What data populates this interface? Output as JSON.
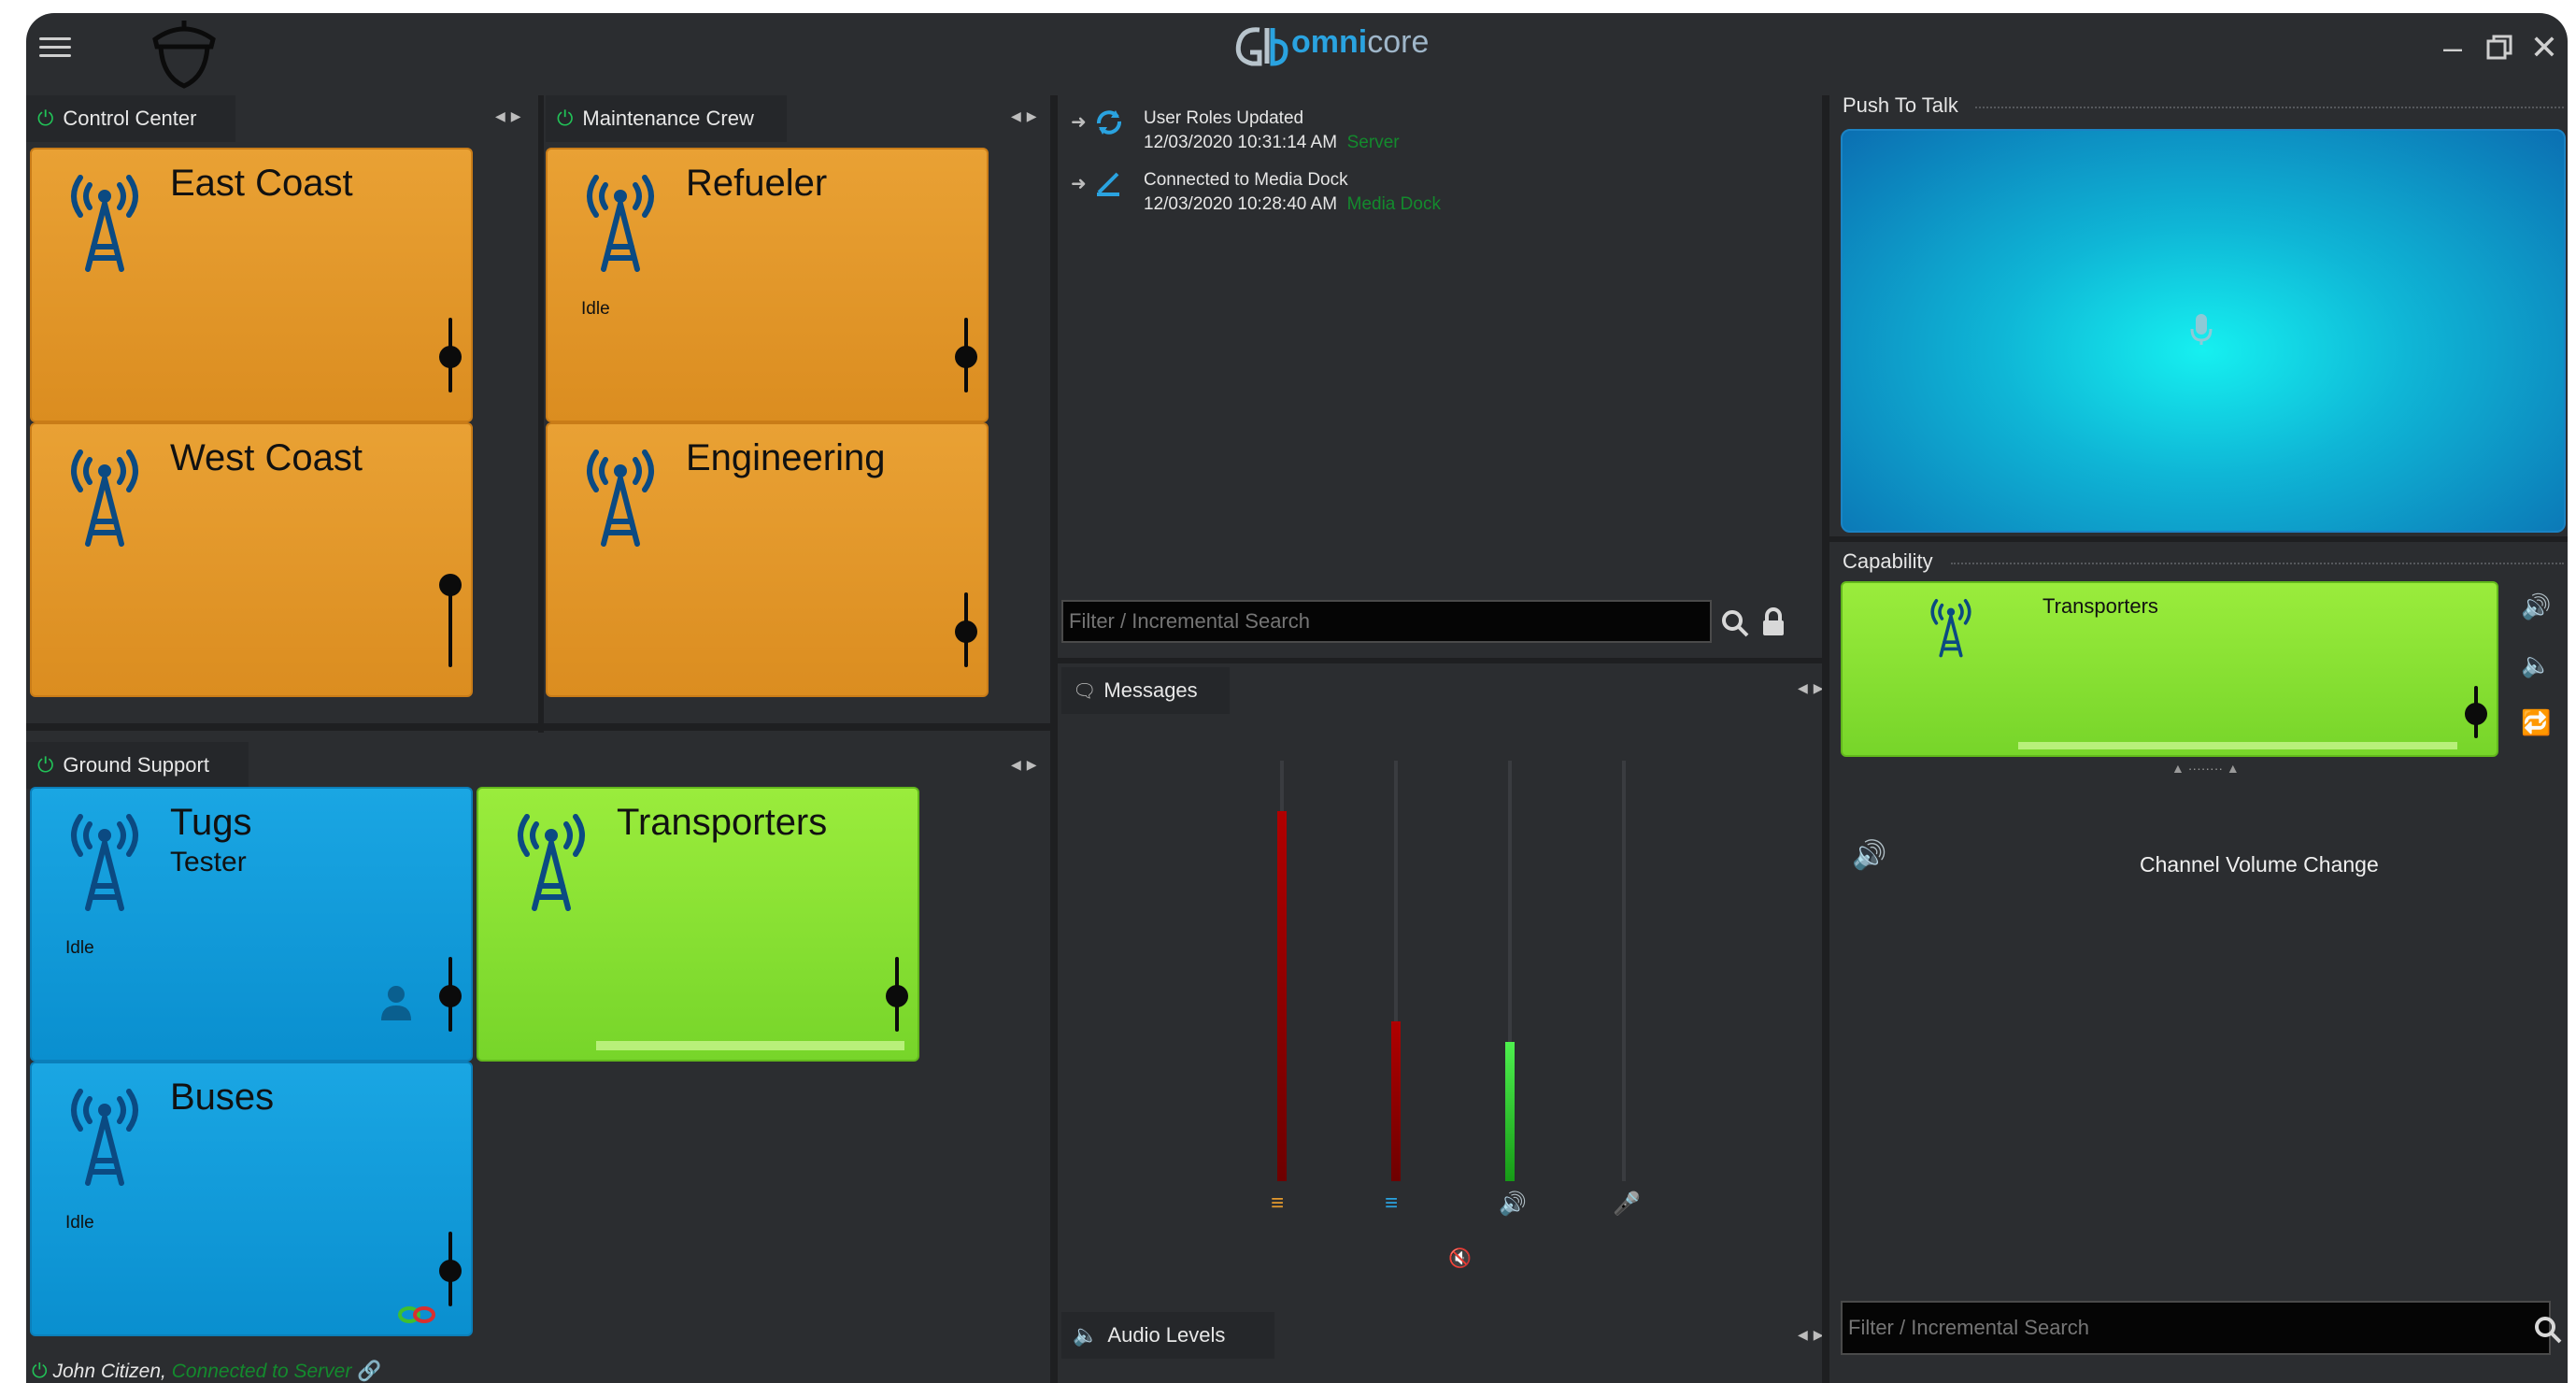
{
  "app": {
    "logo_name": "omni",
    "logo_name2": "core"
  },
  "panels": {
    "control_center": {
      "title": "Control Center"
    },
    "maintenance_crew": {
      "title": "Maintenance Crew"
    },
    "ground_support": {
      "title": "Ground Support"
    }
  },
  "tiles": {
    "east_coast": {
      "name": "East Coast",
      "status": ""
    },
    "west_coast": {
      "name": "West Coast",
      "status": ""
    },
    "refueler": {
      "name": "Refueler",
      "status": "Idle"
    },
    "engineering": {
      "name": "Engineering",
      "status": ""
    },
    "tugs": {
      "name": "Tugs",
      "subtitle": "Tester",
      "status": "Idle"
    },
    "transporters": {
      "name": "Transporters",
      "status": ""
    },
    "buses": {
      "name": "Buses",
      "status": "Idle"
    }
  },
  "log": {
    "entries": [
      {
        "title": "User Roles Updated",
        "time": "12/03/2020 10:31:14 AM",
        "source": "Server"
      },
      {
        "title": "Connected to Media Dock",
        "time": "12/03/2020 10:28:40 AM",
        "source": "Media Dock"
      }
    ],
    "search_placeholder": "Filter / Incremental Search"
  },
  "messages": {
    "title": "Messages"
  },
  "audio_levels": {
    "title": "Audio Levels",
    "meters": [
      {
        "name": "Layers (orange)",
        "level": 0.88,
        "color": "#8b0000"
      },
      {
        "name": "Layers (blue)",
        "level": 0.38,
        "color": "#8b0000"
      },
      {
        "name": "Speaker",
        "level": 0.33,
        "color": "#2ed12e"
      },
      {
        "name": "Microphone",
        "level": 0.0,
        "color": "#3a3c40"
      }
    ]
  },
  "push_to_talk": {
    "title": "Push To Talk"
  },
  "capability": {
    "title": "Capability",
    "channel": "Transporters",
    "event": "Channel Volume Change",
    "search_placeholder": "Filter / Incremental Search"
  },
  "status_bar": {
    "user": "John Citizen,",
    "connection": "Connected to Server"
  },
  "colors": {
    "accent_green": "#21c257",
    "orange_tile": "#e49a2d",
    "blue_tile": "#139ad9",
    "green_tile": "#8be235"
  }
}
